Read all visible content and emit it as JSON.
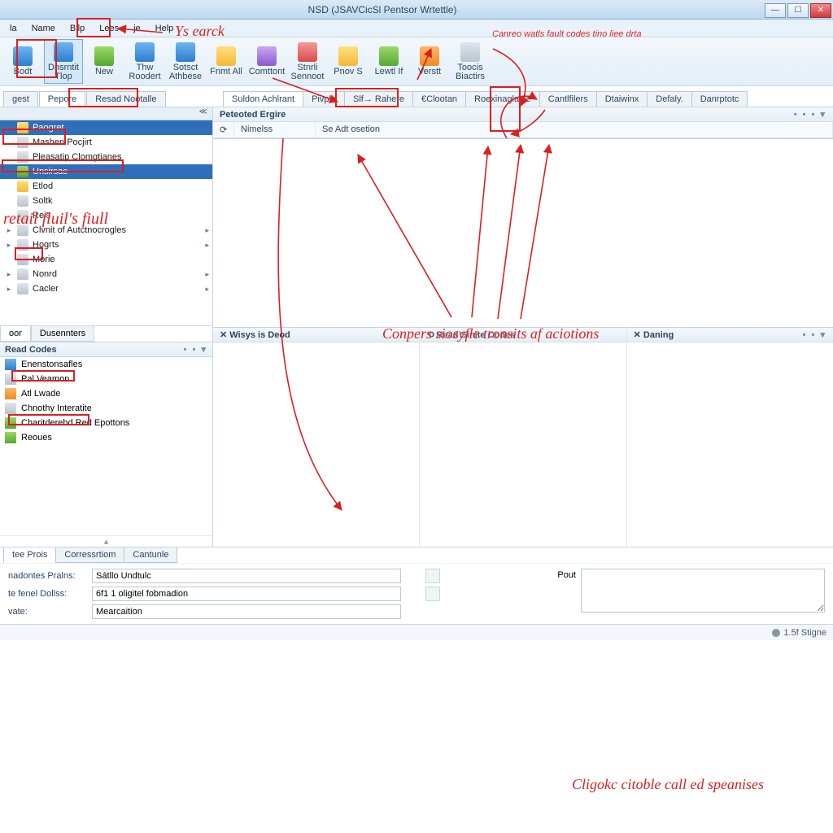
{
  "window": {
    "title": "NSD (JSAVCicSl Pentsor Wrtettle)"
  },
  "menus": [
    "la",
    "Name",
    "Bilp",
    "Lees",
    "je",
    "Help"
  ],
  "toolbar": [
    {
      "label": "Bodt",
      "icon": "c-blue"
    },
    {
      "label": "Dnsrntit Tlop",
      "icon": "c-blue",
      "selected": true
    },
    {
      "label": "New",
      "icon": "c-green"
    },
    {
      "label": "Thw Roodert",
      "icon": "c-blue"
    },
    {
      "label": "Sotsct Athbese",
      "icon": "c-blue"
    },
    {
      "label": "Fnmt All",
      "icon": "c-yellow"
    },
    {
      "label": "Comttont",
      "icon": "c-purple"
    },
    {
      "label": "Stnrli Sennoot",
      "icon": "c-red"
    },
    {
      "label": "Pnov S",
      "icon": "c-yellow"
    },
    {
      "label": "Lewtl If",
      "icon": "c-green"
    },
    {
      "label": "Verstt",
      "icon": "c-orange"
    },
    {
      "label": "Toocis Biactirs",
      "icon": "c-gray"
    }
  ],
  "leftTabs": [
    {
      "label": "gest",
      "active": false
    },
    {
      "label": "Pepore",
      "active": true
    },
    {
      "label": "Resad Nootalle",
      "active": false
    }
  ],
  "contentTabs": [
    {
      "label": "Suldon Achlrant",
      "active": true
    },
    {
      "label": "Pivple"
    },
    {
      "label": "Slf→ Rahere"
    },
    {
      "label": "€Clootan"
    },
    {
      "label": "Roexinaglagle"
    },
    {
      "label": "Cantlfilers"
    },
    {
      "label": "Dtaiwinx"
    },
    {
      "label": "Defaly."
    },
    {
      "label": "Danrptotc"
    }
  ],
  "tree": [
    {
      "label": "Paogret",
      "selected": true,
      "icon": "c-yellow"
    },
    {
      "label": "Mashen Pocjirt",
      "icon": "c-gray"
    },
    {
      "label": "Pleasatip Clomgtianes",
      "icon": "c-gray"
    },
    {
      "label": "Unsirsae",
      "selected": true,
      "icon": "c-green"
    },
    {
      "label": "Etlod",
      "icon": "c-yellow"
    },
    {
      "label": "Soltk",
      "icon": "c-gray"
    },
    {
      "label": "Reis",
      "icon": "c-gray"
    },
    {
      "label": "Clvnit of Autctnocrogles",
      "icon": "c-gray",
      "hasSub": true
    },
    {
      "label": "Hogrts",
      "icon": "c-gray",
      "hasSub": true
    },
    {
      "label": "Morie",
      "icon": "c-gray"
    },
    {
      "label": "Nonrd",
      "icon": "c-gray",
      "hasSub": true
    },
    {
      "label": "Cacler",
      "icon": "c-gray",
      "hasSub": true
    }
  ],
  "sideTabs": [
    {
      "label": "oor",
      "active": true
    },
    {
      "label": "Dusennters"
    }
  ],
  "codes": {
    "title": "Read Codes",
    "items": [
      {
        "label": "Enenstonsafles",
        "icon": "c-blue"
      },
      {
        "label": "Pal Veamon",
        "icon": "c-gray"
      },
      {
        "label": "Atl Lwade",
        "icon": "c-orange"
      },
      {
        "label": "Chnothy Interatite",
        "icon": "c-gray"
      },
      {
        "label": "Charitderehd Red Epottons",
        "icon": "c-green"
      },
      {
        "label": "Reoues",
        "icon": "c-green"
      }
    ]
  },
  "section": {
    "title": "Peteoted Ergire",
    "columns": [
      "",
      "Nimelss",
      "Se Adt osetion"
    ]
  },
  "panels3": [
    "✕  Wisys is Deod",
    "⟲  Read Sinite Codes",
    "✕  Daning"
  ],
  "bottomTabs": [
    {
      "label": "tee Prois",
      "active": true
    },
    {
      "label": "Corressrtiom"
    },
    {
      "label": "Cantunle"
    }
  ],
  "form": {
    "r1_label": "nadontes Pralns:",
    "r1_value": "Sátllo Undtulc",
    "r2_label": "te fenel Dollss:",
    "r2_value": "6f1 1 oligitel fobmadion",
    "r3_label": "vate:",
    "r3_value": "Mearcaition",
    "right_label": "Pout"
  },
  "status": "1.5f Stigne",
  "annotations": {
    "t1": "Ys earck",
    "t2": "Canreo watls fault codes tino liee drta",
    "t3": "retail fluil's fiull",
    "t4": "Conpers siosyfle tronsits af aciotions",
    "t5": "Cligokc citoble call ed speanises"
  }
}
